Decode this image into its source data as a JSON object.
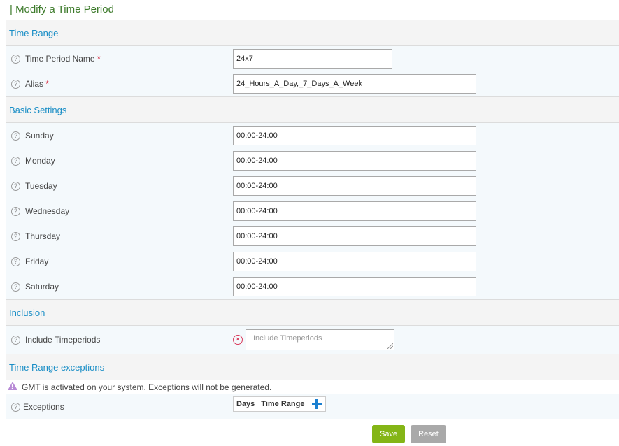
{
  "page_title": "| Modify a Time Period",
  "sections": {
    "time_range": "Time Range",
    "basic_settings": "Basic Settings",
    "inclusion": "Inclusion",
    "exceptions": "Time Range exceptions"
  },
  "help_glyph": "?",
  "required_marker": "*",
  "fields": {
    "name": {
      "label": "Time Period Name",
      "value": "24x7"
    },
    "alias": {
      "label": "Alias",
      "value": "24_Hours_A_Day,_7_Days_A_Week"
    }
  },
  "days": [
    {
      "label": "Sunday",
      "value": "00:00-24:00"
    },
    {
      "label": "Monday",
      "value": "00:00-24:00"
    },
    {
      "label": "Tuesday",
      "value": "00:00-24:00"
    },
    {
      "label": "Wednesday",
      "value": "00:00-24:00"
    },
    {
      "label": "Thursday",
      "value": "00:00-24:00"
    },
    {
      "label": "Friday",
      "value": "00:00-24:00"
    },
    {
      "label": "Saturday",
      "value": "00:00-24:00"
    }
  ],
  "inclusion": {
    "label": "Include Timeperiods",
    "placeholder": "Include Timeperiods",
    "clear_glyph": "×"
  },
  "exceptions": {
    "warning": "GMT is activated on your system. Exceptions will not be generated.",
    "warning_glyph": "!",
    "label": "Exceptions",
    "columns": [
      "Days",
      "Time Range"
    ]
  },
  "buttons": {
    "save": "Save",
    "reset": "Reset"
  },
  "colors": {
    "title": "#3c7a2a",
    "section_text": "#1a8ec6",
    "save_button": "#84b516",
    "reset_button": "#a9a9a9",
    "required": "#d0021b",
    "add_icon": "#1a7fd0"
  },
  "icons": {
    "help": "help-icon",
    "clear": "clear-icon",
    "warning": "warning-icon",
    "add": "plus-icon"
  }
}
